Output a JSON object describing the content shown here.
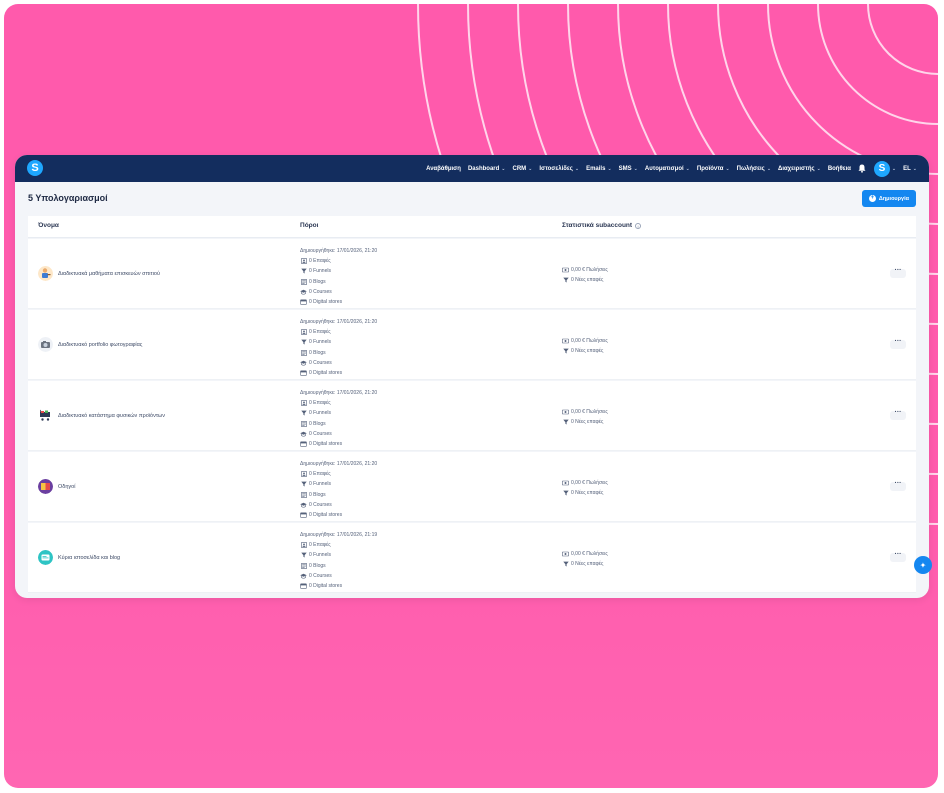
{
  "topbar": {
    "logo_letter": "S",
    "nav": [
      {
        "label": "Αναβάθμιση",
        "has_menu": false
      },
      {
        "label": "Dashboard",
        "has_menu": true
      },
      {
        "label": "CRM",
        "has_menu": true
      },
      {
        "label": "Ιστοσελίδες",
        "has_menu": true
      },
      {
        "label": "Emails",
        "has_menu": true
      },
      {
        "label": "SMS",
        "has_menu": true
      },
      {
        "label": "Αυτοματισμοί",
        "has_menu": true
      },
      {
        "label": "Προϊόντα",
        "has_menu": true
      },
      {
        "label": "Πωλήσεις",
        "has_menu": true
      },
      {
        "label": "Διαχειριστής",
        "has_menu": true
      },
      {
        "label": "Βοήθεια",
        "has_menu": false
      }
    ],
    "avatar_letter": "S",
    "language": "EL"
  },
  "page": {
    "title": "5 Υπολογαριασμοί",
    "create_label": "Δημιουργία"
  },
  "table": {
    "headers": {
      "name": "Όνομα",
      "resources": "Πόροι",
      "stats": "Στατιστικά subaccount"
    },
    "rows": [
      {
        "name": "Διαδικτυακά μαθήματα επισκευών σπιτιού",
        "icon": "repairman-icon",
        "created": "Δημιουργήθηκε: 17/01/2026, 21:20",
        "contacts": "0 Επαφές",
        "funnels": "0 Funnels",
        "blogs": "0 Blogs",
        "courses": "0 Courses",
        "stores": "0 Digital stores",
        "sales": "0,00 € Πωλήσεις",
        "new_contacts": "0 Νέες επαφές"
      },
      {
        "name": "Διαδικτυακό portfolio φωτογραφίας",
        "icon": "camera-icon",
        "created": "Δημιουργήθηκε: 17/01/2026, 21:20",
        "contacts": "0 Επαφές",
        "funnels": "0 Funnels",
        "blogs": "0 Blogs",
        "courses": "0 Courses",
        "stores": "0 Digital stores",
        "sales": "0,00 € Πωλήσεις",
        "new_contacts": "0 Νέες επαφές"
      },
      {
        "name": "Διαδικτυακό κατάστημα φυσικών προϊόντων",
        "icon": "shopping-cart-icon",
        "created": "Δημιουργήθηκε: 17/01/2026, 21:20",
        "contacts": "0 Επαφές",
        "funnels": "0 Funnels",
        "blogs": "0 Blogs",
        "courses": "0 Courses",
        "stores": "0 Digital stores",
        "sales": "0,00 € Πωλήσεις",
        "new_contacts": "0 Νέες επαφές"
      },
      {
        "name": "Οδηγοί",
        "icon": "book-icon",
        "created": "Δημιουργήθηκε: 17/01/2026, 21:20",
        "contacts": "0 Επαφές",
        "funnels": "0 Funnels",
        "blogs": "0 Blogs",
        "courses": "0 Courses",
        "stores": "0 Digital stores",
        "sales": "0,00 € Πωλήσεις",
        "new_contacts": "0 Νέες επαφές"
      },
      {
        "name": "Κύρια ιστοσελίδα και blog",
        "icon": "website-icon",
        "created": "Δημιουργήθηκε: 17/01/2026, 21:19",
        "contacts": "0 Επαφές",
        "funnels": "0 Funnels",
        "blogs": "0 Blogs",
        "courses": "0 Courses",
        "stores": "0 Digital stores",
        "sales": "0,00 € Πωλήσεις",
        "new_contacts": "0 Νέες επαφές"
      }
    ]
  },
  "colors": {
    "background": "#ff5aac",
    "topbar": "#132d5e",
    "accent": "#1487f0"
  }
}
